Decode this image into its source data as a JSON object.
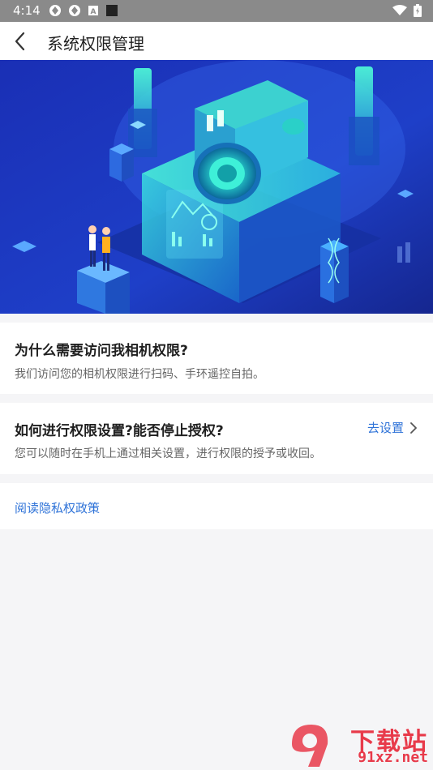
{
  "status_bar": {
    "time": "4:14"
  },
  "app_bar": {
    "title": "系统权限管理"
  },
  "section1": {
    "title": "为什么需要访问我相机权限?",
    "desc": "我们访问您的相机权限进行扫码、手环遥控自拍。"
  },
  "section2": {
    "title": "如何进行权限设置?能否停止授权?",
    "desc": "您可以随时在手机上通过相关设置，进行权限的授予或收回。",
    "link": "去设置"
  },
  "section3": {
    "link": "阅读隐私权政策"
  },
  "watermark": {
    "top": "下载站",
    "bottom": "91xz.net"
  },
  "colors": {
    "link": "#2f73d8",
    "accent_red": "#e83a4a"
  }
}
